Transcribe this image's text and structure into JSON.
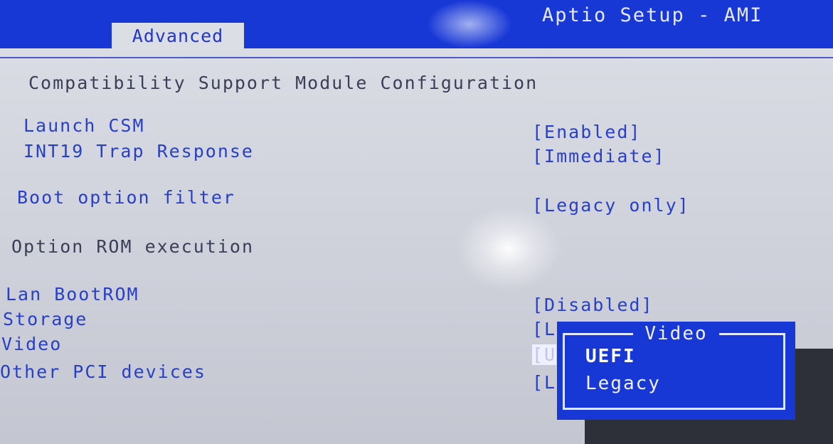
{
  "header": {
    "app_title": "Aptio Setup - AMI",
    "tab": "Advanced"
  },
  "section": {
    "title": "Compatibility Support Module Configuration"
  },
  "settings": [
    {
      "label": "Launch CSM",
      "value": "[Enabled]"
    },
    {
      "label": "INT19 Trap Response",
      "value": "[Immediate]"
    },
    {
      "label": "Boot option filter",
      "value": "[Legacy only]"
    }
  ],
  "option_rom": {
    "heading": "Option ROM execution",
    "items": [
      {
        "label": "Lan BootROM",
        "value": "[Disabled]"
      },
      {
        "label": "Storage",
        "value": "[L"
      },
      {
        "label": "Video",
        "value": "[U"
      },
      {
        "label": "Other PCI devices",
        "value": "[L"
      }
    ]
  },
  "popup": {
    "title": "Video",
    "options": [
      "UEFI",
      "Legacy"
    ],
    "selected": "UEFI"
  },
  "colors": {
    "header_bg": "#1838d6",
    "label_blue": "#2840c8",
    "screen_bg": "#d5d7e0"
  }
}
